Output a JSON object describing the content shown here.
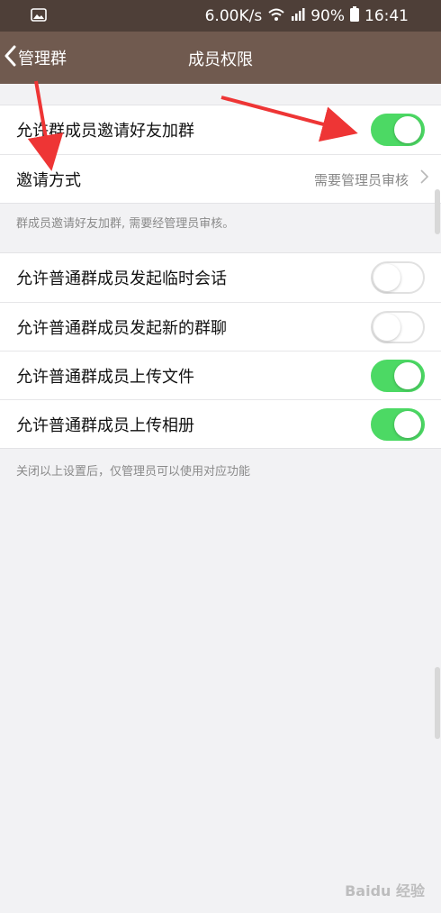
{
  "status": {
    "speed": "6.00K/s",
    "battery": "90%",
    "time": "16:41"
  },
  "nav": {
    "back_label": "管理群",
    "title": "成员权限"
  },
  "section1": {
    "rows": [
      {
        "label": "允许群成员邀请好友加群",
        "toggle": true
      },
      {
        "label": "邀请方式",
        "value": "需要管理员审核"
      }
    ],
    "note": "群成员邀请好友加群, 需要经管理员审核。"
  },
  "section2": {
    "rows": [
      {
        "label": "允许普通群成员发起临时会话",
        "toggle": false
      },
      {
        "label": "允许普通群成员发起新的群聊",
        "toggle": false
      },
      {
        "label": "允许普通群成员上传文件",
        "toggle": true
      },
      {
        "label": "允许普通群成员上传相册",
        "toggle": true
      }
    ],
    "note": "关闭以上设置后，仅管理员可以使用对应功能"
  },
  "colors": {
    "status_bar": "#4e3f38",
    "nav_bar": "#705a4f",
    "toggle_on": "#4cd964",
    "arrow": "#ee3535"
  },
  "watermark": "Baidu 经验"
}
